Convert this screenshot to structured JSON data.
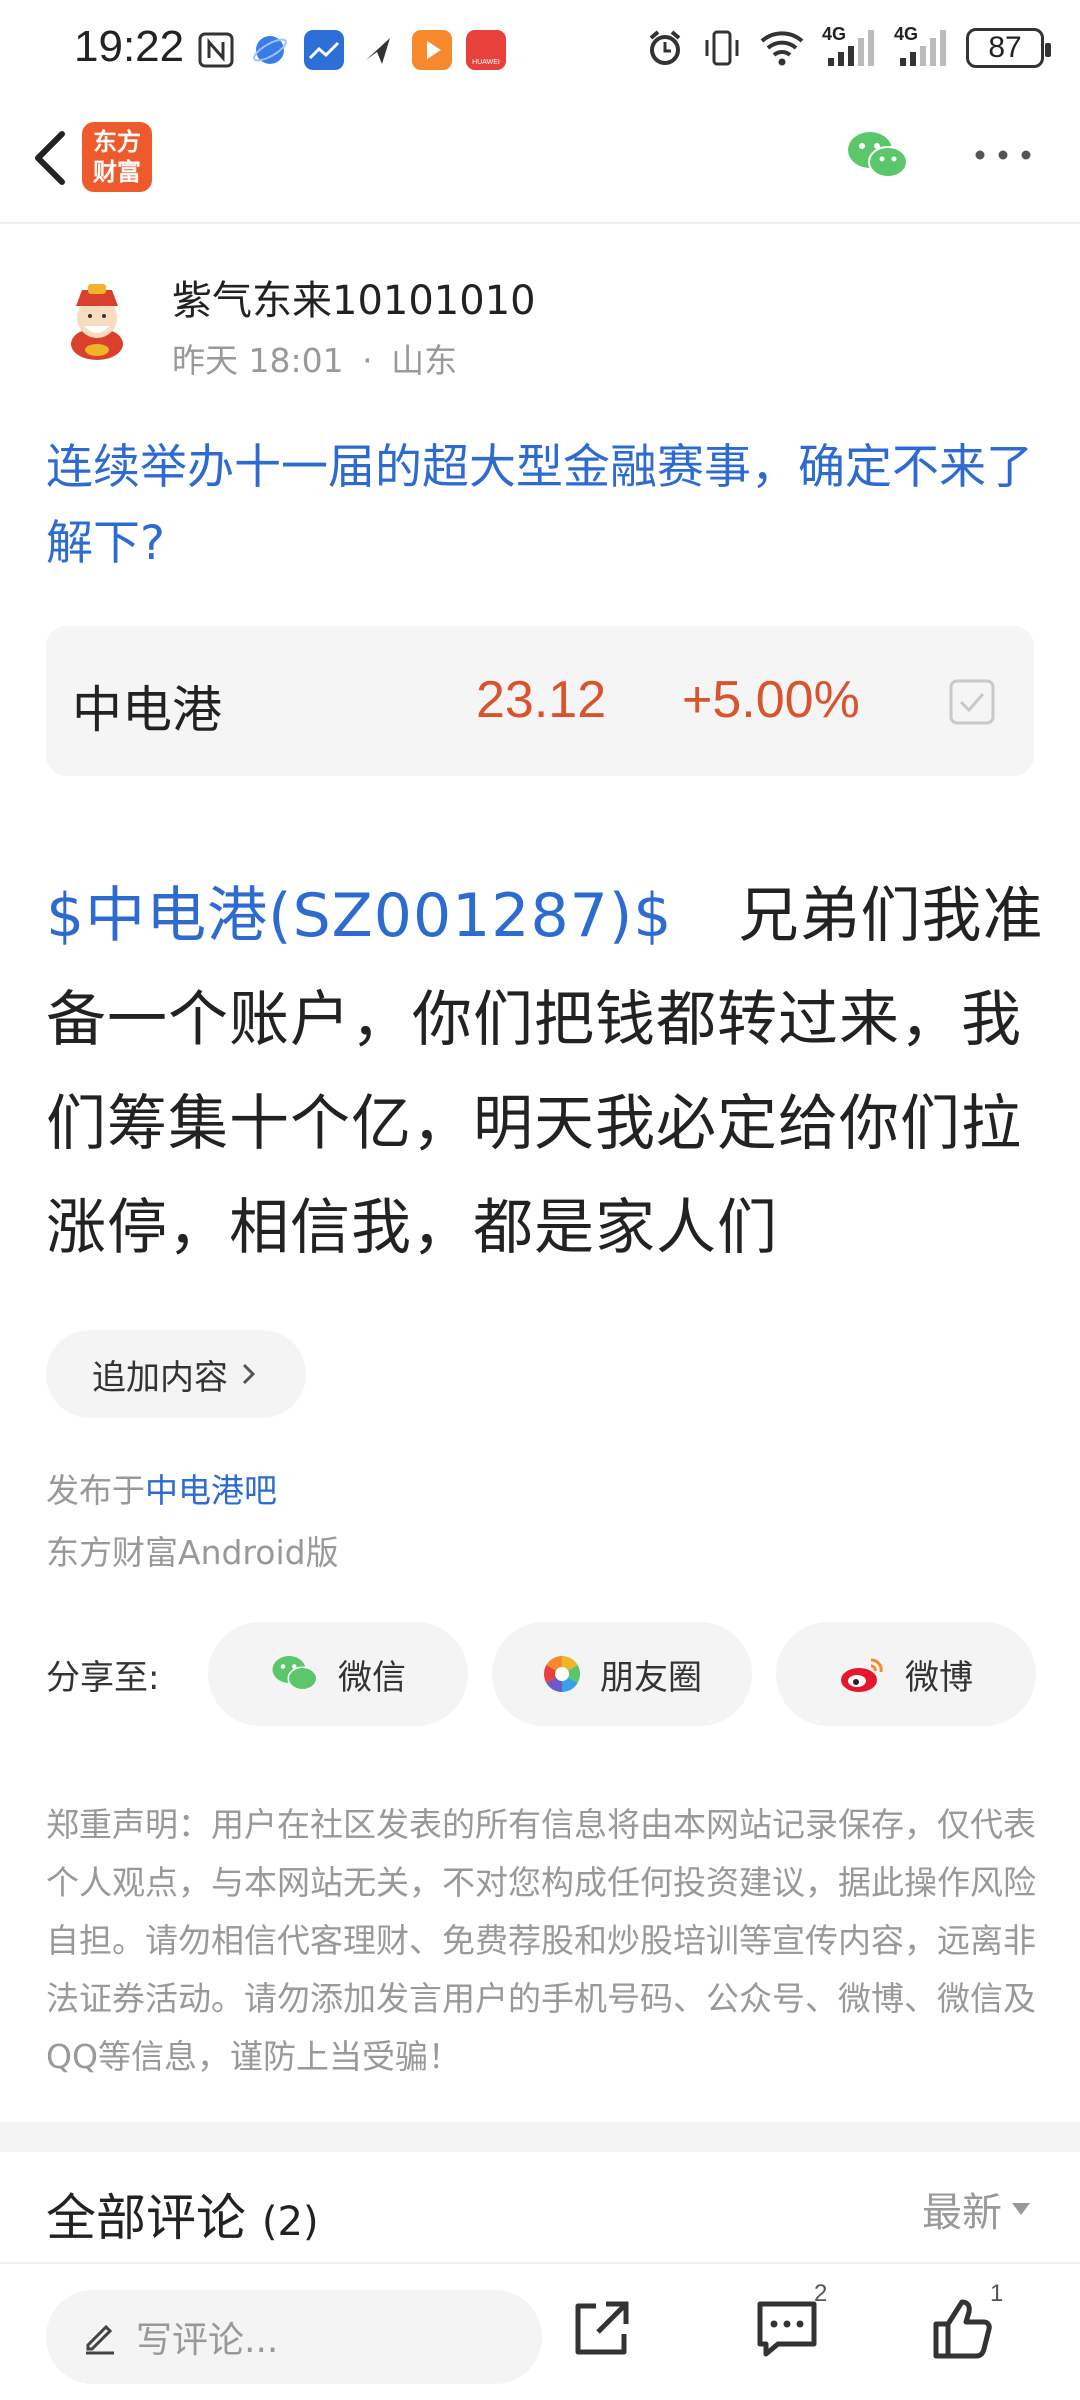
{
  "status_bar": {
    "time": "19:22",
    "battery": "87",
    "network_1": "4G",
    "network_2": "4G",
    "app_icon_labels": [
      "HUAWEI"
    ]
  },
  "nav": {
    "logo_line1": "东方",
    "logo_line2": "财富"
  },
  "author": {
    "name": "紫气东来10101010",
    "time": "昨天 18:01",
    "separator": "·",
    "location": "山东"
  },
  "post": {
    "title": "连续举办十一届的超大型金融赛事，确定不来了解下?",
    "stock_tag": "$中电港(SZ001287)$",
    "body": "兄弟们我准备一个账户，你们把钱都转过来，我们筹集十个亿，明天我必定给你们拉涨停，相信我，都是家人们",
    "append_label": "追加内容",
    "published_prefix": "发布于",
    "published_bar": "中电港吧",
    "platform": "东方财富Android版"
  },
  "stock_card": {
    "name": "中电港",
    "price": "23.12",
    "change": "+5.00%",
    "colors": {
      "up": "#d9532c"
    }
  },
  "share": {
    "label": "分享至:",
    "targets": [
      {
        "label": "微信",
        "icon": "wechat-icon"
      },
      {
        "label": "朋友圈",
        "icon": "moments-icon"
      },
      {
        "label": "微博",
        "icon": "weibo-icon"
      }
    ]
  },
  "disclaimer": "郑重声明：用户在社区发表的所有信息将由本网站记录保存，仅代表个人观点，与本网站无关，不对您构成任何投资建议，据此操作风险自担。请勿相信代客理财、免费荐股和炒股培训等宣传内容，远离非法证券活动。请勿添加发言用户的手机号码、公众号、微博、微信及QQ等信息，谨防上当受骗！",
  "comments": {
    "title": "全部评论",
    "count": "(2)",
    "sort": "最新"
  },
  "bottom_bar": {
    "input_placeholder": "写评论...",
    "comment_count": "2",
    "like_count": "1"
  },
  "colors": {
    "link": "#2d6bd1",
    "brand": "#ef5a2c"
  }
}
